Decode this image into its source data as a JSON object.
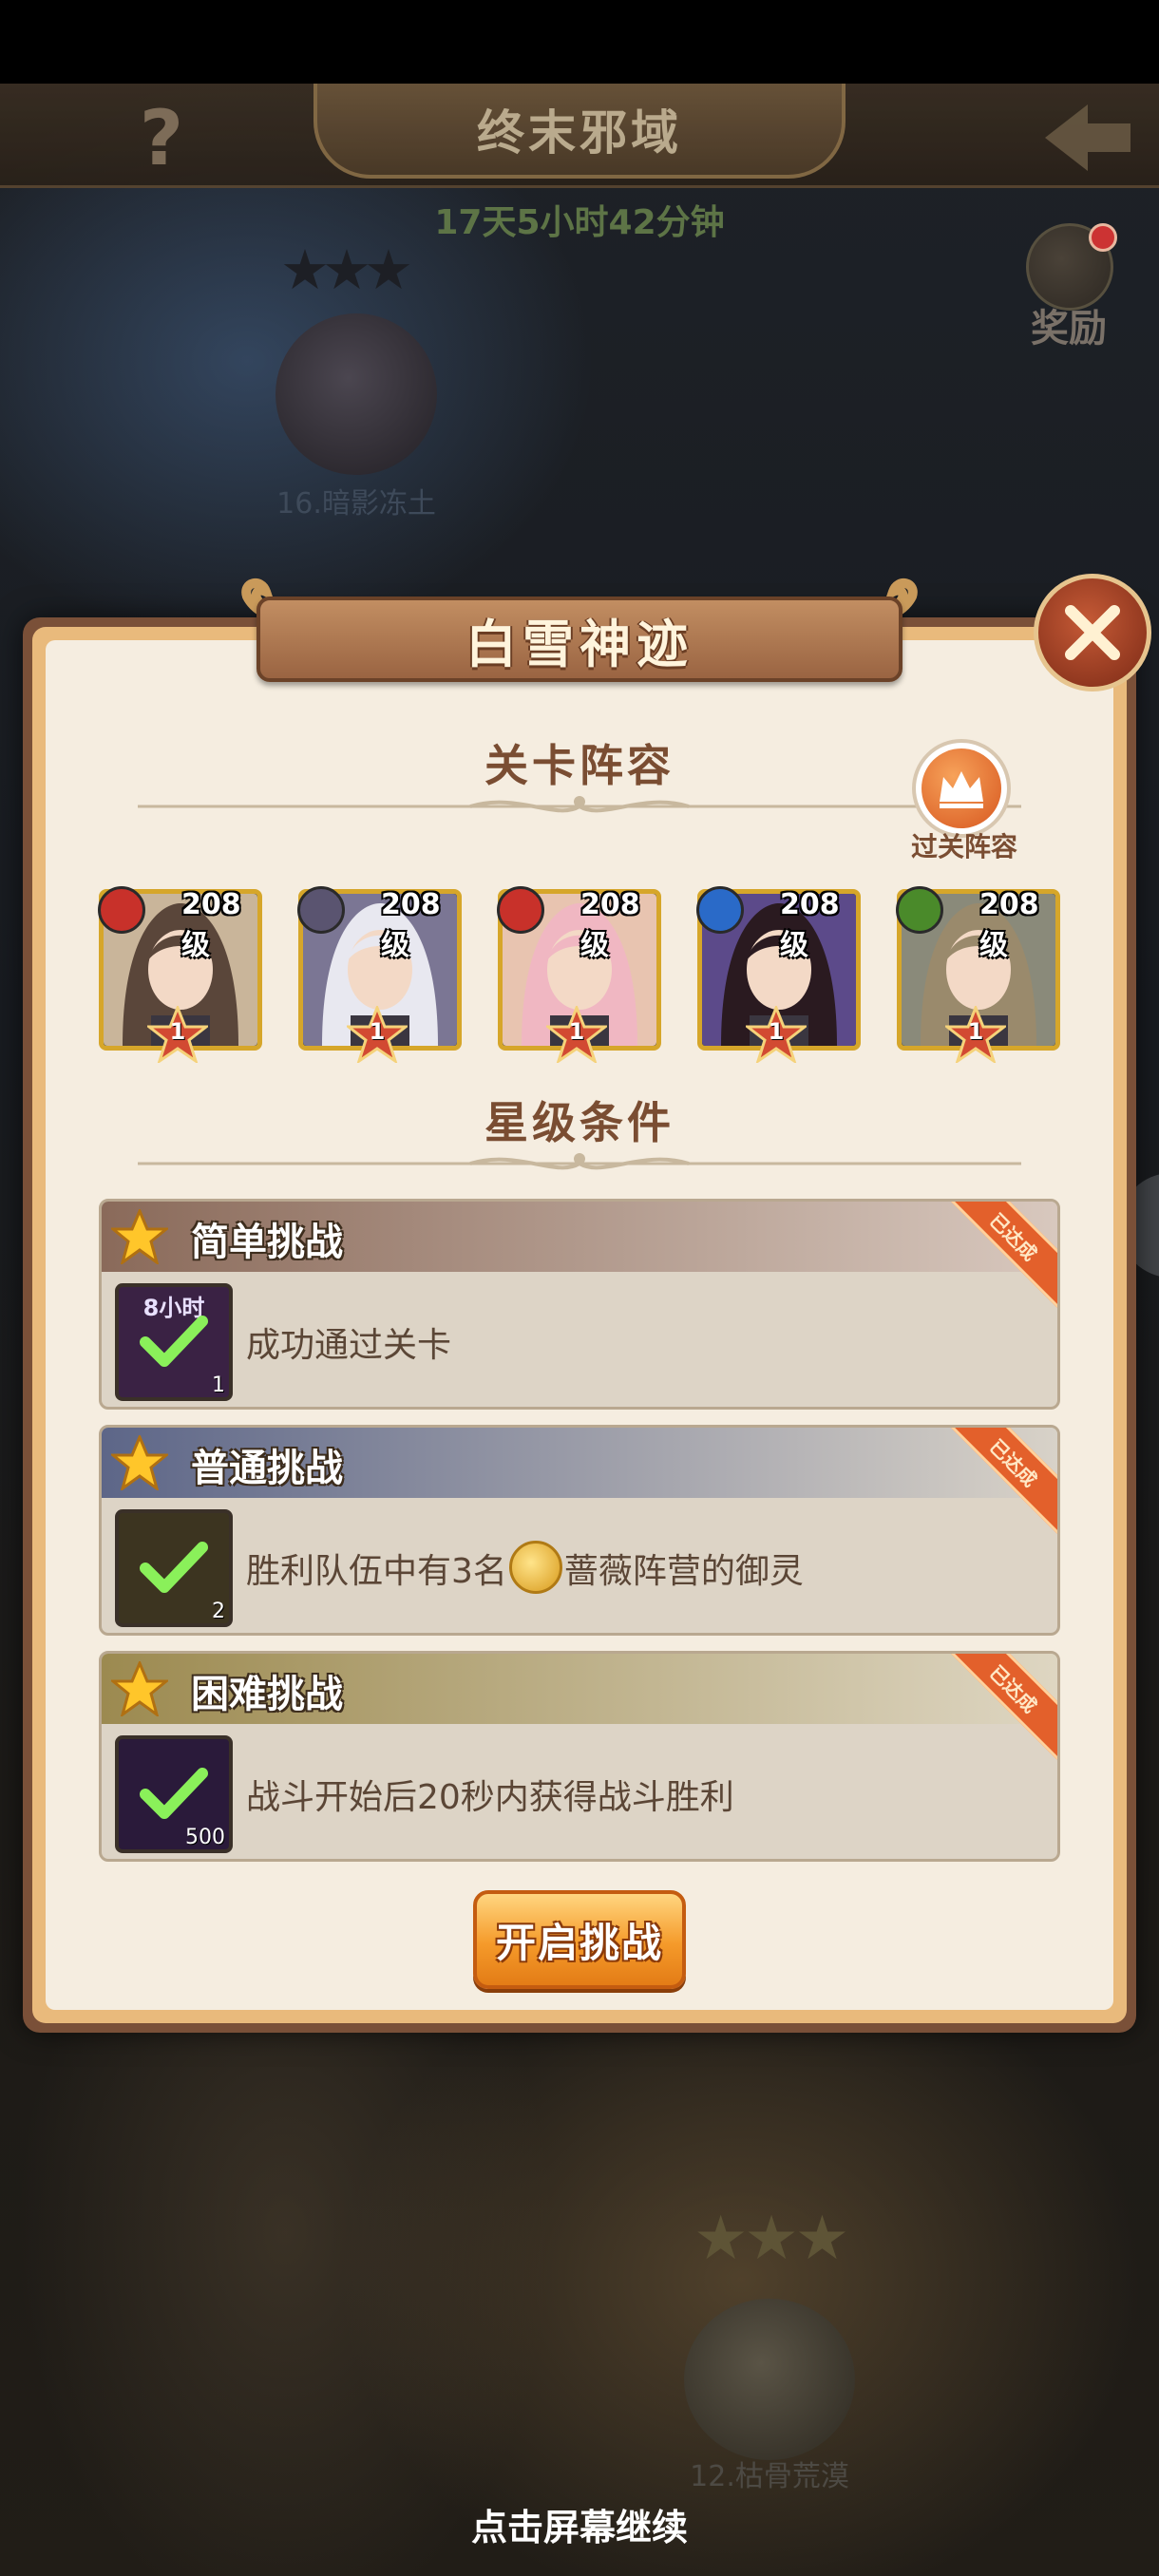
{
  "map": {
    "title": "终末邪域",
    "help_symbol": "?",
    "countdown": "17天5小时42分钟",
    "reward_label": "奖励",
    "node_top_label": "16.暗影冻土",
    "node_bottom_label": "12.枯骨荒漠",
    "node_bottom_stars": 3,
    "continue_hint": "点击屏幕继续"
  },
  "dialog": {
    "title": "白雪神迹",
    "close_symbol": "✕",
    "lineup_title": "关卡阵容",
    "pass_lineup_label": "过关阵容",
    "conditions_title": "星级条件",
    "start_button": "开启挑战"
  },
  "heroes": [
    {
      "level": "208级",
      "faction": "fire",
      "stars": "1",
      "hair": "#5a463a",
      "bg": "#c9b59a"
    },
    {
      "level": "208级",
      "faction": "shadow",
      "stars": "1",
      "hair": "#e8e8f0",
      "bg": "#7b7694"
    },
    {
      "level": "208级",
      "faction": "fire",
      "stars": "1",
      "hair": "#f0b7c2",
      "bg": "#e8c4b0"
    },
    {
      "level": "208级",
      "faction": "water",
      "stars": "1",
      "hair": "#2a1a20",
      "bg": "#5c4a8a"
    },
    {
      "level": "208级",
      "faction": "nature",
      "stars": "1",
      "hair": "#9a8a6c",
      "bg": "#8a8a7a"
    }
  ],
  "challenges": [
    {
      "title": "简单挑战",
      "badge": "已达成",
      "icon_top": "8小时",
      "icon_count": "1",
      "desc": "成功通过关卡",
      "head_colors": [
        "#8a6a5a",
        "#d8c8be"
      ],
      "icon_bg": "#3a2244"
    },
    {
      "title": "普通挑战",
      "badge": "已达成",
      "icon_top": "",
      "icon_count": "2",
      "desc_before": "胜利队伍中有3名",
      "desc_after": "蔷薇阵营的御灵",
      "head_colors": [
        "#5d6688",
        "#d8d2c8"
      ],
      "icon_bg": "#3c3420"
    },
    {
      "title": "困难挑战",
      "badge": "已达成",
      "icon_top": "",
      "icon_count": "500",
      "desc": "战斗开始后20秒内获得战斗胜利",
      "head_colors": [
        "#9c8a50",
        "#ded6c2"
      ],
      "icon_bg": "#2a1a3a"
    }
  ],
  "colors": {
    "fire": "#c8312a",
    "shadow": "#5a5470",
    "water": "#2a6ac8",
    "nature": "#4a8a2a",
    "accent_orange": "#f59a2a"
  }
}
